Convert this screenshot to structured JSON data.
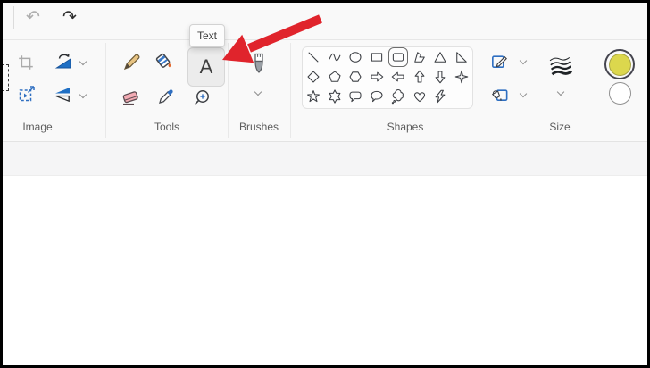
{
  "topbar": {
    "undo_icon": "↶",
    "redo_icon": "↷"
  },
  "tooltip": {
    "text": "Text"
  },
  "annotation_arrow": {
    "color": "#e0242c"
  },
  "ribbon": {
    "groups": [
      {
        "label": "Image"
      },
      {
        "label": "Tools"
      },
      {
        "label": "Brushes"
      },
      {
        "label": "Shapes"
      },
      {
        "label": "Size"
      }
    ],
    "image_tools": [
      "select",
      "crop",
      "rotate",
      "resize",
      "flip"
    ],
    "tools": [
      "pencil",
      "fill-color",
      "text",
      "eraser",
      "color-picker",
      "magnifier"
    ],
    "selected_tool": "text",
    "shapes": {
      "selected": "rounded-rectangle",
      "items": [
        "line",
        "curve",
        "oval",
        "rectangle",
        "rounded-rectangle",
        "polygon",
        "triangle",
        "right-triangle",
        "diamond",
        "pentagon",
        "hexagon",
        "arrow-right",
        "arrow-left",
        "arrow-up",
        "arrow-down",
        "star-four",
        "star-five",
        "star-six",
        "speech-rounded",
        "speech-oval",
        "speech-cloud",
        "heart",
        "lightning"
      ]
    }
  },
  "colors": {
    "primary": "#dcd74d",
    "secondary": "#ffffff",
    "selection_ring": "#45454f"
  }
}
